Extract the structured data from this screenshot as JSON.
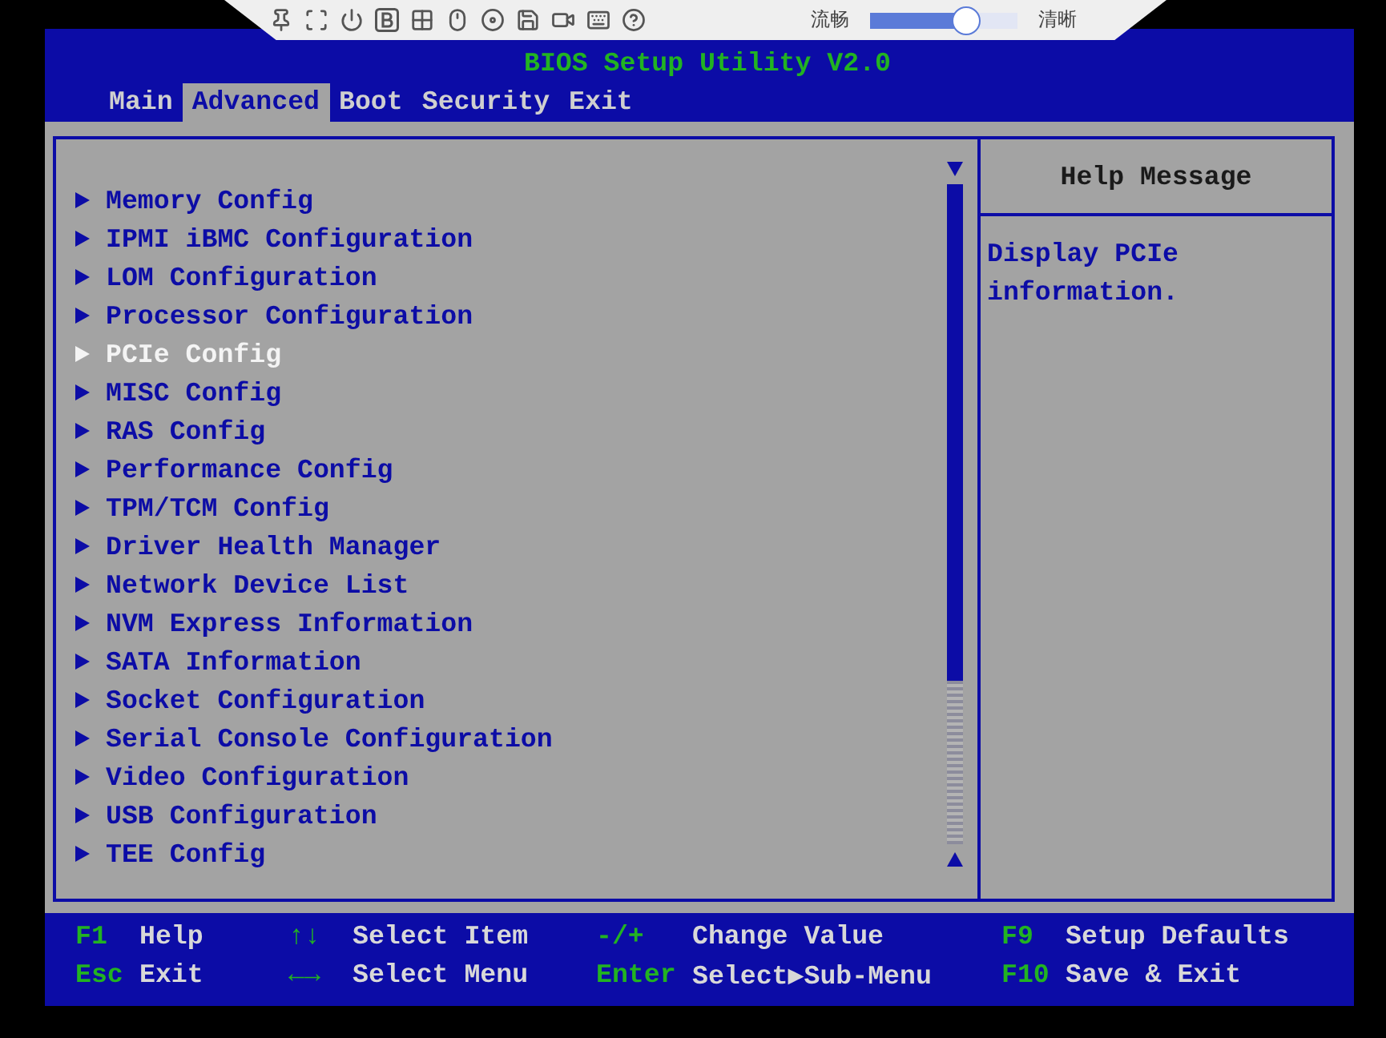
{
  "remote_toolbar": {
    "quality": {
      "left_label": "流畅",
      "right_label": "清晰",
      "level": 0.65
    }
  },
  "bios": {
    "title": "BIOS Setup Utility V2.0",
    "tabs": [
      {
        "label": "Main",
        "selected": false
      },
      {
        "label": "Advanced",
        "selected": true
      },
      {
        "label": "Boot",
        "selected": false
      },
      {
        "label": "Security",
        "selected": false
      },
      {
        "label": "Exit",
        "selected": false
      }
    ],
    "menu_items": [
      {
        "label": "Memory Config",
        "selected": false
      },
      {
        "label": "IPMI iBMC Configuration",
        "selected": false
      },
      {
        "label": "LOM Configuration",
        "selected": false
      },
      {
        "label": "Processor Configuration",
        "selected": false
      },
      {
        "label": "PCIe Config",
        "selected": true
      },
      {
        "label": "MISC Config",
        "selected": false
      },
      {
        "label": "RAS Config",
        "selected": false
      },
      {
        "label": "Performance Config",
        "selected": false
      },
      {
        "label": "TPM/TCM Config",
        "selected": false
      },
      {
        "label": "Driver Health Manager",
        "selected": false
      },
      {
        "label": "Network Device List",
        "selected": false
      },
      {
        "label": "NVM Express Information",
        "selected": false
      },
      {
        "label": "SATA Information",
        "selected": false
      },
      {
        "label": "Socket Configuration",
        "selected": false
      },
      {
        "label": "Serial Console Configuration",
        "selected": false
      },
      {
        "label": "Video Configuration",
        "selected": false
      },
      {
        "label": "USB Configuration",
        "selected": false
      },
      {
        "label": "TEE Config",
        "selected": false
      }
    ],
    "help": {
      "title": "Help Message",
      "text": "Display PCIe information."
    },
    "legend": [
      {
        "key": "F1",
        "action": "Help"
      },
      {
        "key": "↑↓",
        "action": "Select Item"
      },
      {
        "key": "-/+",
        "action": "Change Value"
      },
      {
        "key": "F9",
        "action": "Setup Defaults"
      },
      {
        "key": "Esc",
        "action": "Exit"
      },
      {
        "key": "←→",
        "action": "Select Menu"
      },
      {
        "key": "Enter",
        "action": "Select▶Sub-Menu"
      },
      {
        "key": "F10",
        "action": "Save & Exit"
      }
    ]
  }
}
